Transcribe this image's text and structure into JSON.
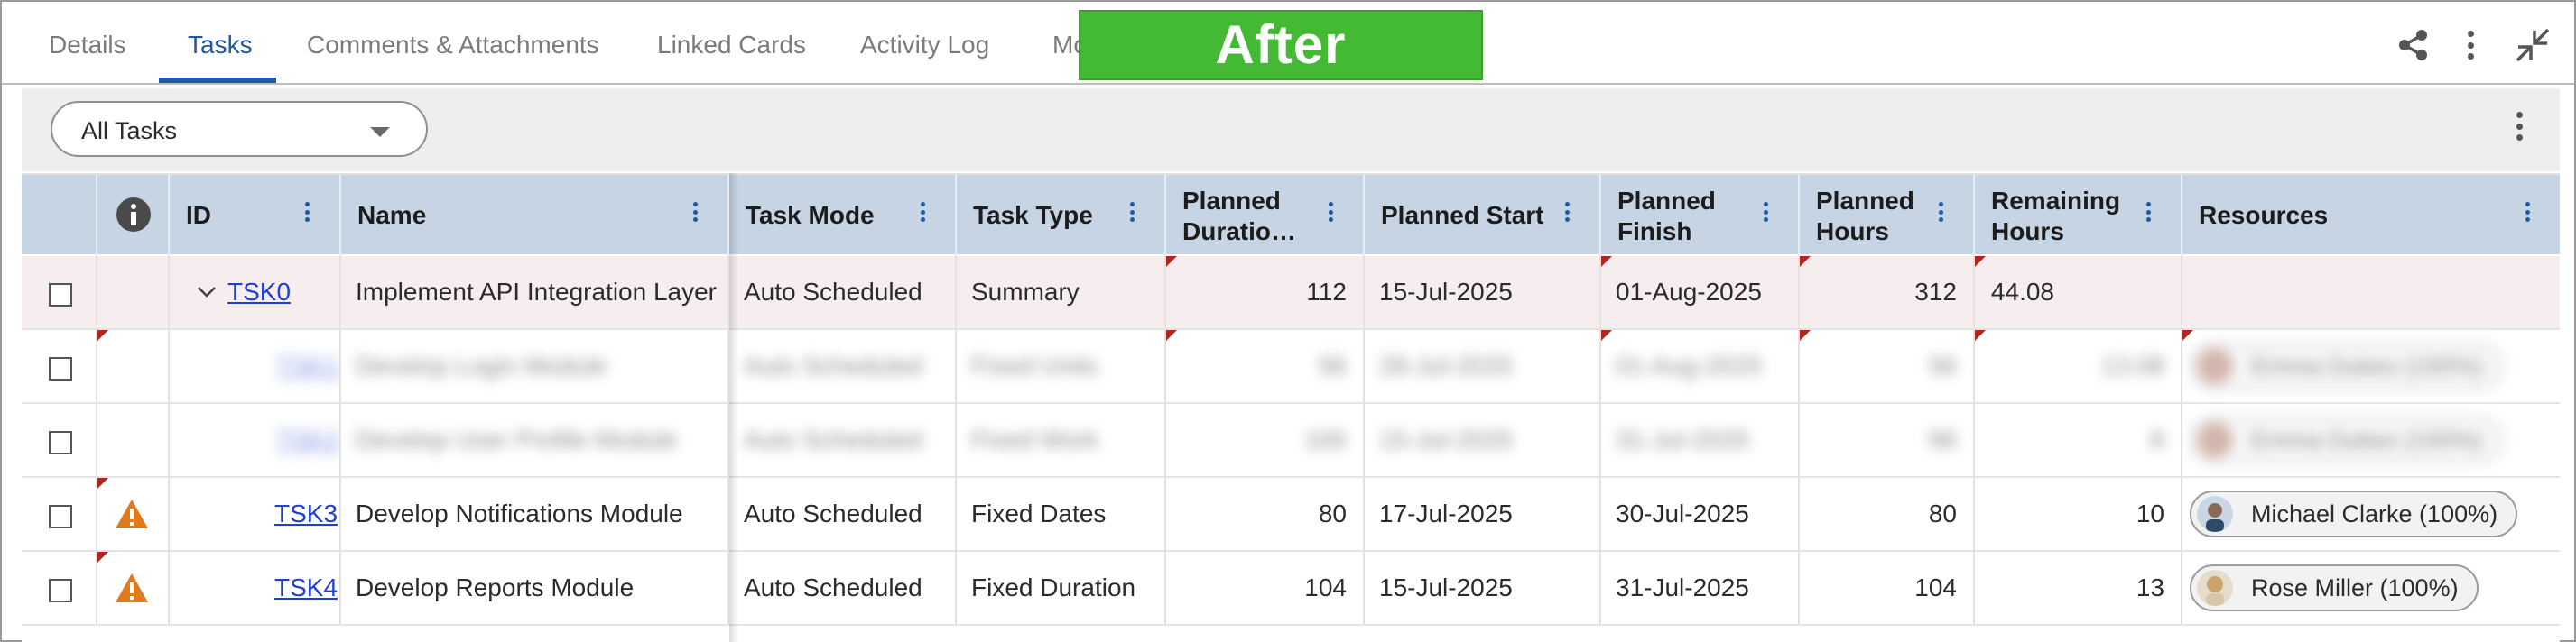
{
  "tabs": [
    {
      "label": "Details",
      "active": false
    },
    {
      "label": "Tasks",
      "active": true
    },
    {
      "label": "Comments & Attachments",
      "active": false
    },
    {
      "label": "Linked Cards",
      "active": false
    },
    {
      "label": "Activity Log",
      "active": false
    }
  ],
  "tab_overflow": "Mo",
  "badge": "After",
  "header_icons": [
    "share-icon",
    "more-vertical-icon",
    "collapse-icon"
  ],
  "filter": {
    "selected": "All Tasks"
  },
  "columns": {
    "id": "ID",
    "name": "Name",
    "task_mode": "Task Mode",
    "task_type": "Task Type",
    "planned_duration": "Planned Duratio…",
    "planned_start": "Planned Start",
    "planned_finish": "Planned Finish",
    "planned_hours": "Planned Hours",
    "remaining_hours": "Remaining Hours",
    "resources": "Resources"
  },
  "columns_split": {
    "planned_duration": [
      "Planned",
      "Duratio…"
    ],
    "planned_finish": [
      "Planned",
      "Finish"
    ],
    "planned_hours": [
      "Planned",
      "Hours"
    ],
    "remaining_hours": [
      "Remaining",
      "Hours"
    ]
  },
  "rows": [
    {
      "id": "TSK0",
      "name": "Implement API Integration Layer",
      "task_mode": "Auto Scheduled",
      "task_type": "Summary",
      "planned_duration": "112",
      "planned_start": "15-Jul-2025",
      "planned_finish": "01-Aug-2025",
      "planned_hours": "312",
      "remaining_hours": "44.08",
      "resource": "",
      "warning": false,
      "blurred": false,
      "summary": true
    },
    {
      "id": "TSK1",
      "name": "Develop Login Module",
      "task_mode": "Auto Scheduled",
      "task_type": "Fixed Units",
      "planned_duration": "56",
      "planned_start": "28-Jul-2025",
      "planned_finish": "01-Aug-2025",
      "planned_hours": "56",
      "remaining_hours": "13.08",
      "resource": "Emma Dukes (100%)",
      "warning": false,
      "blurred": true,
      "summary": false
    },
    {
      "id": "TSK2",
      "name": "Develop User Profile Module",
      "task_mode": "Auto Scheduled",
      "task_type": "Fixed Work",
      "planned_duration": "100",
      "planned_start": "15-Jul-2025",
      "planned_finish": "31-Jul-2025",
      "planned_hours": "96",
      "remaining_hours": "8",
      "resource": "Emma Dukes (100%)",
      "warning": false,
      "blurred": true,
      "summary": false
    },
    {
      "id": "TSK3",
      "name": "Develop Notifications Module",
      "task_mode": "Auto Scheduled",
      "task_type": "Fixed Dates",
      "planned_duration": "80",
      "planned_start": "17-Jul-2025",
      "planned_finish": "30-Jul-2025",
      "planned_hours": "80",
      "remaining_hours": "10",
      "resource": "Michael Clarke (100%)",
      "warning": true,
      "blurred": false,
      "summary": false
    },
    {
      "id": "TSK4",
      "name": "Develop Reports Module",
      "task_mode": "Auto Scheduled",
      "task_type": "Fixed Duration",
      "planned_duration": "104",
      "planned_start": "15-Jul-2025",
      "planned_finish": "31-Jul-2025",
      "planned_hours": "104",
      "remaining_hours": "13",
      "resource": "Rose Miller (100%)",
      "warning": true,
      "blurred": false,
      "summary": false
    }
  ],
  "colors": {
    "accent": "#1f5aa8",
    "header_bg": "#c7d4e4",
    "badge": "#44b934",
    "warning": "#e07a1f",
    "link": "#1f3fd0"
  }
}
